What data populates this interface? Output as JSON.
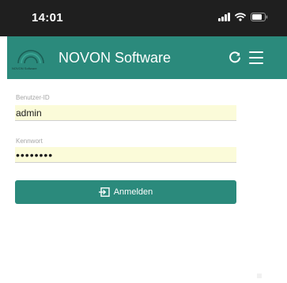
{
  "status_bar": {
    "time": "14:01",
    "icons": [
      "signal-icon",
      "wifi-icon",
      "battery-icon"
    ]
  },
  "app_bar": {
    "logo_caption": "NOVON Software",
    "title": "NOVON Software",
    "actions": [
      "refresh-icon",
      "menu-icon"
    ],
    "color": "#2b8a7c"
  },
  "login_form": {
    "user_id_label": "Benutzer-ID",
    "user_id_value": "admin",
    "password_label": "Kennwort",
    "password_value": "••••••••",
    "input_background": "#fbfbd9",
    "submit_label": "Anmelden",
    "submit_icon": "login-icon"
  }
}
